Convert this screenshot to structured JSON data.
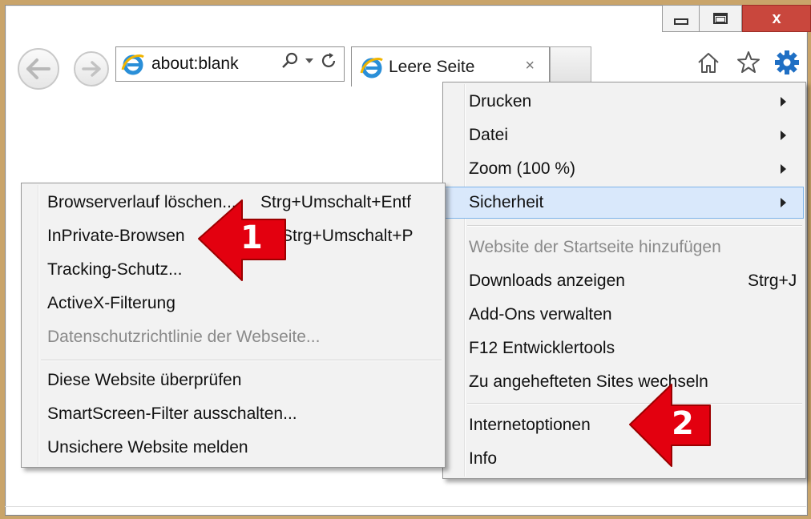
{
  "window": {
    "close_glyph": "x"
  },
  "address_bar": {
    "url": "about:blank"
  },
  "tab": {
    "title": "Leere Seite",
    "close_glyph": "×"
  },
  "toolbar_icons": [
    "home-icon",
    "favorites-star-icon",
    "tools-gear-icon"
  ],
  "tools_menu": {
    "items": [
      {
        "label": "Drucken",
        "submenu": true
      },
      {
        "label": "Datei",
        "submenu": true
      },
      {
        "label": "Zoom (100 %)",
        "submenu": true
      },
      {
        "label": "Sicherheit",
        "submenu": true,
        "highlighted": true
      },
      {
        "label": "Website der Startseite hinzufügen",
        "disabled": true
      },
      {
        "label": "Downloads anzeigen",
        "shortcut": "Strg+J"
      },
      {
        "label": "Add-Ons verwalten"
      },
      {
        "label": "F12 Entwicklertools"
      },
      {
        "label": "Zu angehefteten Sites wechseln"
      },
      {
        "label": "Internetoptionen"
      },
      {
        "label": "Info"
      }
    ]
  },
  "security_submenu": {
    "items": [
      {
        "label": "Browserverlauf löschen...",
        "shortcut": "Strg+Umschalt+Entf"
      },
      {
        "label": "InPrivate-Browsen",
        "shortcut": "Strg+Umschalt+P"
      },
      {
        "label": "Tracking-Schutz..."
      },
      {
        "label": "ActiveX-Filterung"
      },
      {
        "label": "Datenschutzrichtlinie der Webseite...",
        "disabled": true
      },
      {
        "label": "Diese Website überprüfen"
      },
      {
        "label": "SmartScreen-Filter ausschalten..."
      },
      {
        "label": "Unsichere Website melden"
      }
    ]
  },
  "callouts": [
    {
      "number": "1"
    },
    {
      "number": "2"
    }
  ],
  "colors": {
    "callout_red": "#e3000f",
    "highlight_bg": "#d9e8fb",
    "highlight_border": "#7eb4ea",
    "close_button": "#c9473d",
    "gear_blue": "#1f6fc4"
  }
}
